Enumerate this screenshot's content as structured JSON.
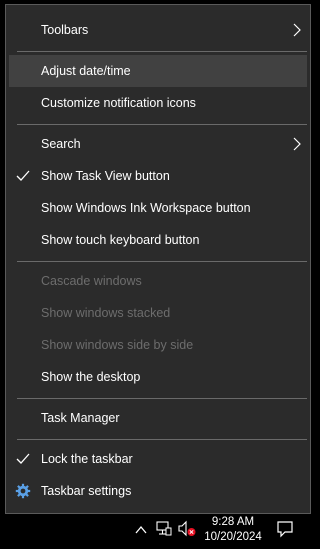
{
  "menu": {
    "items": [
      {
        "label": "Toolbars",
        "submenu": true
      },
      {
        "label": "Adjust date/time"
      },
      {
        "label": "Customize notification icons"
      },
      {
        "label": "Search",
        "submenu": true
      },
      {
        "label": "Show Task View button",
        "checked": true
      },
      {
        "label": "Show Windows Ink Workspace button"
      },
      {
        "label": "Show touch keyboard button"
      },
      {
        "label": "Cascade windows",
        "disabled": true
      },
      {
        "label": "Show windows stacked",
        "disabled": true
      },
      {
        "label": "Show windows side by side",
        "disabled": true
      },
      {
        "label": "Show the desktop"
      },
      {
        "label": "Task Manager"
      },
      {
        "label": "Lock the taskbar",
        "checked": true
      },
      {
        "label": "Taskbar settings",
        "icon": "gear-icon"
      }
    ]
  },
  "taskbar": {
    "time": "9:28 AM",
    "date": "10/20/2024",
    "tray_icons": [
      "chevron-up-icon",
      "network-icon",
      "volume-muted-icon",
      "notification-icon"
    ]
  },
  "colors": {
    "menu_bg": "#2b2b2b",
    "hover_bg": "#414141",
    "text": "#ffffff",
    "disabled_text": "#6d6d6d",
    "separator": "#6a6a6a"
  }
}
